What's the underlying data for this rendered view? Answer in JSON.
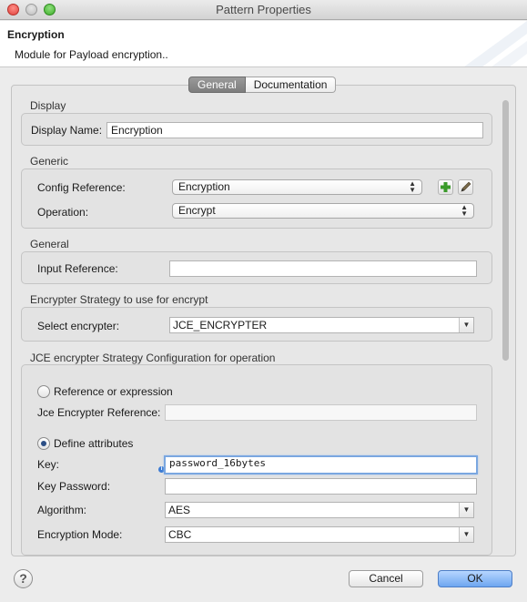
{
  "window": {
    "title": "Pattern Properties"
  },
  "header": {
    "title": "Encryption",
    "description": "Module for Payload encryption.."
  },
  "tabs": [
    {
      "label": "General",
      "active": true
    },
    {
      "label": "Documentation",
      "active": false
    }
  ],
  "display": {
    "section_title": "Display",
    "display_name_label": "Display Name:",
    "display_name_value": "Encryption"
  },
  "generic": {
    "section_title": "Generic",
    "config_reference_label": "Config Reference:",
    "config_reference_value": "Encryption",
    "operation_label": "Operation:",
    "operation_value": "Encrypt",
    "add_icon": "plus-icon",
    "edit_icon": "pencil-icon"
  },
  "general": {
    "section_title": "General",
    "input_reference_label": "Input Reference:",
    "input_reference_value": ""
  },
  "encrypter_strategy": {
    "section_title": "Encrypter Strategy to use for encrypt",
    "select_label": "Select encrypter:",
    "select_value": "JCE_ENCRYPTER"
  },
  "jce_config": {
    "section_title": "JCE encrypter Strategy Configuration for operation",
    "radio_reference_label": "Reference or expression",
    "radio_reference_checked": false,
    "jce_reference_label": "Jce Encrypter Reference:",
    "jce_reference_value": "",
    "radio_define_label": "Define attributes",
    "radio_define_checked": true,
    "key_label": "Key:",
    "key_value": "password_16bytes",
    "key_password_label": "Key Password:",
    "key_password_value": "",
    "algorithm_label": "Algorithm:",
    "algorithm_value": "AES",
    "encryption_mode_label": "Encryption Mode:",
    "encryption_mode_value": "CBC"
  },
  "footer": {
    "help_icon": "question-icon",
    "help_glyph": "?",
    "cancel_label": "Cancel",
    "ok_label": "OK"
  },
  "colors": {
    "ok_button": "#6ea6f0",
    "focus_ring": "#7aa7e0",
    "add_icon": "#3a9a2a"
  }
}
